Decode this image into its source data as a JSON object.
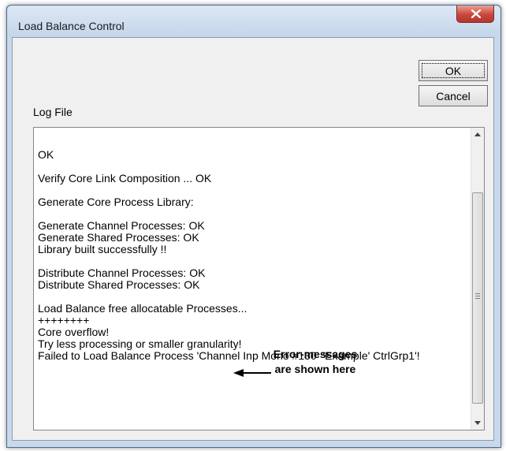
{
  "window": {
    "title": "Load Balance Control",
    "close_label": "x"
  },
  "buttons": {
    "ok": "OK",
    "cancel": "Cancel"
  },
  "log": {
    "label": "Log File",
    "lines": [
      "",
      "OK",
      "",
      "Verify Core Link Composition ... OK",
      "",
      "Generate Core Process Library:",
      "",
      "Generate Channel Processes: OK",
      "Generate Shared Processes: OK",
      "Library built successfully !!",
      "",
      "Distribute Channel Processes: OK",
      "Distribute Shared Processes: OK",
      "",
      "Load Balance free allocatable Processes...",
      "++++++++",
      "Core overflow!",
      "Try less processing or smaller granularity!",
      "Failed to Load Balance Process 'Channel Inp Mono #130  'Example' CtrlGrp1'!"
    ]
  },
  "annotation": {
    "line1": "Error-messages",
    "line2": "are shown here"
  },
  "icons": {
    "close": "close-icon",
    "scroll_up": "scroll-up-arrow-icon",
    "scroll_down": "scroll-down-arrow-icon",
    "callout_arrow": "arrow-left-icon"
  },
  "colors": {
    "titlebar": "#c4d6ea",
    "close_button": "#c9463b",
    "dialog_background": "#f0f0f0"
  }
}
